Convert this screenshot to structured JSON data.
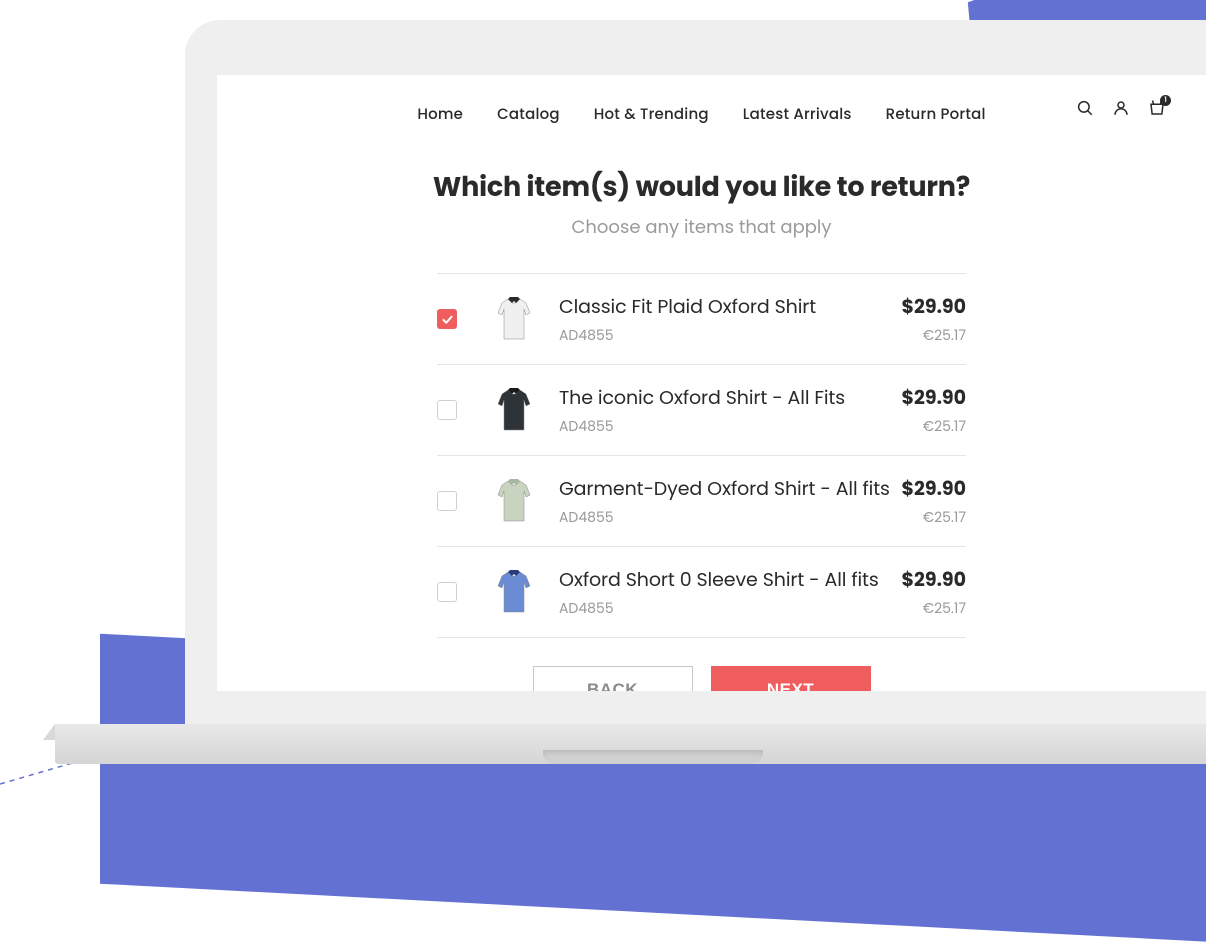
{
  "nav": {
    "links": [
      "Home",
      "Catalog",
      "Hot & Trending",
      "Latest Arrivals",
      "Return Portal"
    ],
    "cart_badge": "1"
  },
  "heading": {
    "title": "Which item(s) would you like to return?",
    "subtitle": "Choose any items that apply"
  },
  "items": [
    {
      "name": "Classic Fit Plaid Oxford Shirt",
      "sku": "AD4855",
      "price": "$29.90",
      "price_alt": "€25.17",
      "checked": true,
      "color": "#f0f0f0",
      "collar": "#2a2a2a"
    },
    {
      "name": "The iconic Oxford Shirt - All Fits",
      "sku": "AD4855",
      "price": "$29.90",
      "price_alt": "€25.17",
      "checked": false,
      "color": "#2e3338",
      "collar": "#1a1a1a"
    },
    {
      "name": "Garment-Dyed Oxford Shirt - All fits",
      "sku": "AD4855",
      "price": "$29.90",
      "price_alt": "€25.17",
      "checked": false,
      "color": "#c8d4c0",
      "collar": "#a8b8a0"
    },
    {
      "name": "Oxford Short 0 Sleeve Shirt - All fits",
      "sku": "AD4855",
      "price": "$29.90",
      "price_alt": "€25.17",
      "checked": false,
      "color": "#6a8cd4",
      "collar": "#2a3a7a"
    }
  ],
  "buttons": {
    "back": "BACK",
    "next": "NEXT"
  }
}
